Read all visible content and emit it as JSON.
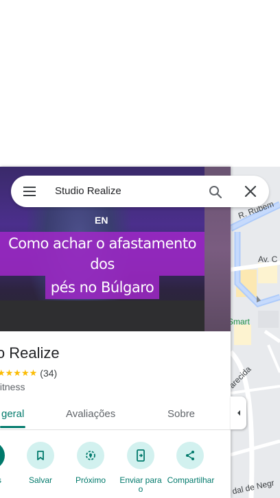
{
  "search": {
    "query": "Studio Realize"
  },
  "hero": {
    "caption_line1": "Como achar o afastamento dos",
    "caption_line2": "pés no Búlgaro",
    "overlay_text": "EN"
  },
  "place": {
    "title": "io Realize",
    "stars": "★★★★★",
    "review_count": "(34)",
    "category": "fitness"
  },
  "tabs": [
    {
      "label": "geral",
      "active": true
    },
    {
      "label": "Avaliações",
      "active": false
    },
    {
      "label": "Sobre",
      "active": false
    }
  ],
  "actions": [
    {
      "label": "s",
      "icon": "directions-icon"
    },
    {
      "label": "Salvar",
      "icon": "bookmark-icon"
    },
    {
      "label": "Próximo",
      "icon": "nearby-icon"
    },
    {
      "label": "Enviar para o",
      "icon": "send-to-phone-icon"
    },
    {
      "label": "Compartilhar",
      "icon": "share-icon"
    }
  ],
  "map": {
    "labels": [
      "R. Rubem",
      "Av. C",
      "Smart",
      "arecida",
      "dal de Negr"
    ]
  },
  "colors": {
    "accent": "#00796b",
    "action_bg": "#d2f1ef",
    "caption_bg": "#a028c8",
    "star": "#fbbc04",
    "map_bg": "#e8eaed",
    "road": "#aecbfa"
  }
}
